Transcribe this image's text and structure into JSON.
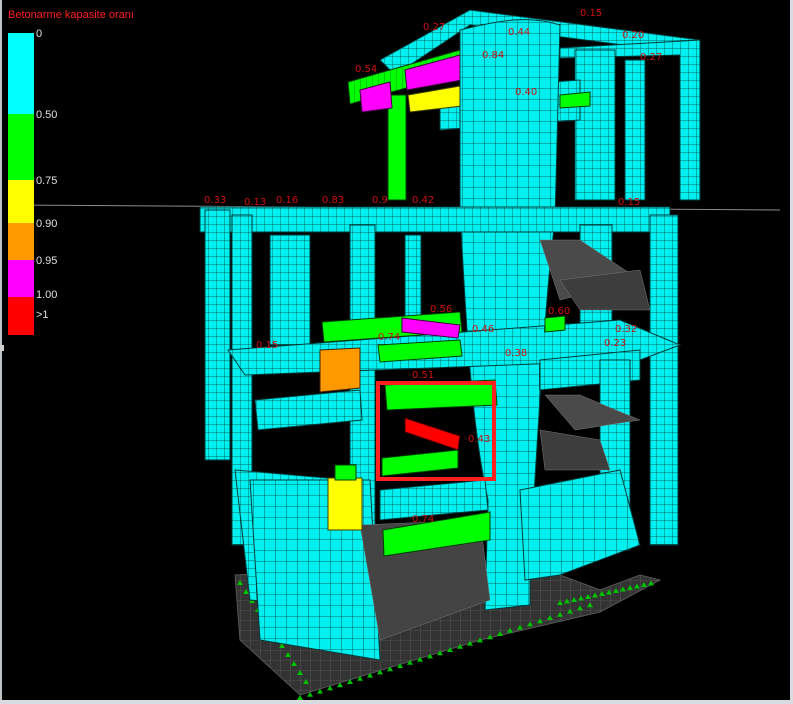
{
  "legend": {
    "title": "Betonarme kapasite oranı",
    "items": [
      {
        "label": "0",
        "color": "#00ffff"
      },
      {
        "label": "0.50",
        "color": "#00ff00"
      },
      {
        "label": "0.75",
        "color": "#ffff00"
      },
      {
        "label": "0.90",
        "color": "#ff9900"
      },
      {
        "label": "0.95",
        "color": "#ff00ff"
      },
      {
        "label": "1.00",
        "color": "#ff0000"
      },
      {
        "label": ">1",
        "color": "#ff0000"
      }
    ]
  },
  "model": {
    "colors": {
      "element_fill": "#00f0f0",
      "mesh_line": "#003b3b",
      "ground_fill": "#3a3a3a",
      "support_marker": "#00c000",
      "ratio_text": "#d01010",
      "selection_box": "#ff2020"
    },
    "member_ratio_labels": [
      "0.33",
      "0.13",
      "0.16",
      "0.83",
      "0.9",
      "0.42",
      "0.15",
      "0.20",
      "0.27",
      "0.54",
      "0.27",
      "0.44",
      "0.84",
      "0.40",
      "0.15",
      "0.56",
      "0.74",
      "0.46",
      "0.60",
      "0.32",
      "0.23",
      "0.15",
      "0.51",
      "0.74",
      "0.43",
      "0.38"
    ]
  }
}
